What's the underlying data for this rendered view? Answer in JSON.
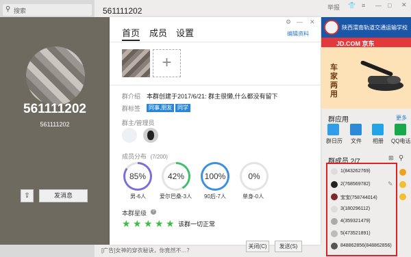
{
  "sidebar": {
    "search_placeholder": "搜索"
  },
  "chat": {
    "title": "561111202",
    "top_right_label": "举报"
  },
  "profile": {
    "display_name": "561111202",
    "number": "561111202",
    "share_icon": "share-icon",
    "message_label": "发消息"
  },
  "card": {
    "tabs": [
      "首页",
      "成员",
      "设置"
    ],
    "edit_label": "编辑资料",
    "intro_label": "群介绍",
    "intro_text": "本群创建于2017/6/21:  群主很懒,什么都没有留下",
    "tag_label": "群标签",
    "tags": [
      "同事,朋友",
      "同学"
    ],
    "admin_label": "群主/管理员",
    "dist_label": "成员分布",
    "dist_count": "(7/200)",
    "stats": [
      {
        "value": "85%",
        "label": "男-6人",
        "pct": 85,
        "color": "#7b6fd6"
      },
      {
        "value": "42%",
        "label": "爱尔巴桑-3人",
        "pct": 42,
        "color": "#3fbf6a"
      },
      {
        "value": "100%",
        "label": "90后-7人",
        "pct": 100,
        "color": "#3c8ee0"
      },
      {
        "value": "0%",
        "label": "单身-0人",
        "pct": 0,
        "color": "#cccccc"
      }
    ],
    "level_label": "本群星级",
    "stars": 5,
    "star_color": "#3dbb42",
    "star_note": "该群一切正常"
  },
  "footer": {
    "ad_text": "[广告]女神的穿衣秘诀，你竟然不…？",
    "close_label": "关闭(C)",
    "send_label": "发送(S)"
  },
  "ads": {
    "top_text": "陕西渭南轨道交通运输学校",
    "jd_brand": "JD.COM 京东",
    "jd_text": "车家两用"
  },
  "apps": {
    "title": "群应用",
    "more_label": "更多",
    "items": [
      {
        "label": "群日历",
        "color": "#2f9de8"
      },
      {
        "label": "文件",
        "color": "#2d8ad8"
      },
      {
        "label": "相册",
        "color": "#22a4e6"
      },
      {
        "label": "QQ电话",
        "color": "#1aa84c"
      }
    ]
  },
  "members": {
    "title": "群成员 2/7",
    "list": [
      {
        "name": "1(843262769)"
      },
      {
        "name": "2(768569782)"
      },
      {
        "name": "宝宝(758744014)"
      },
      {
        "name": "3(180296112)"
      },
      {
        "name": "4(359321479)"
      },
      {
        "name": "5(473521891)"
      },
      {
        "name": "848862856(848862856)"
      }
    ],
    "highlight_color": "#e02020"
  }
}
